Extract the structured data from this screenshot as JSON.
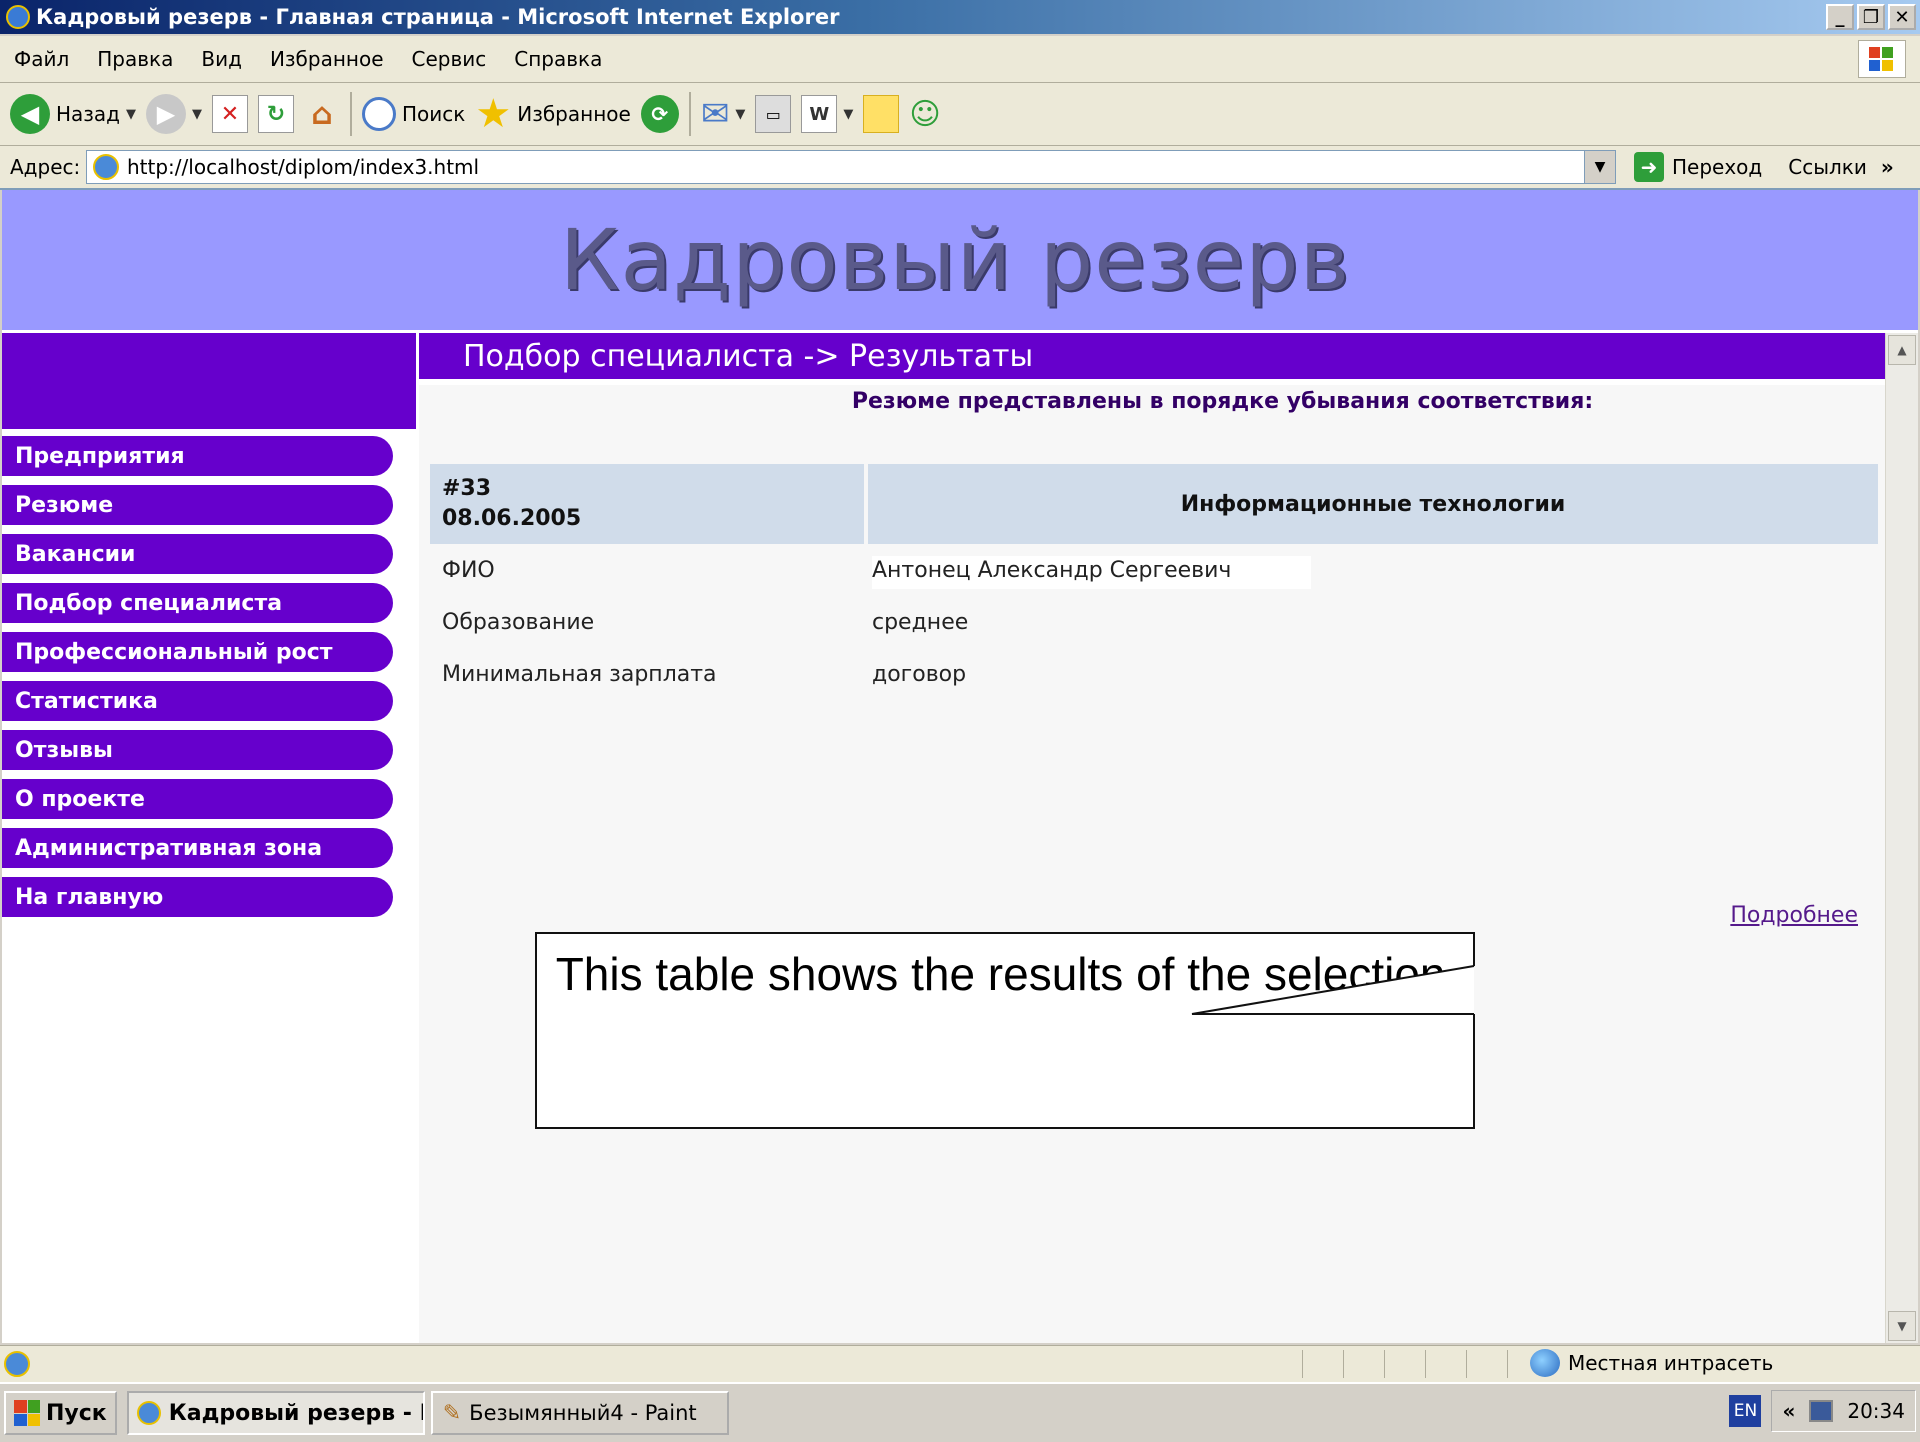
{
  "window": {
    "title": "Кадровый резерв - Главная страница - Microsoft Internet Explorer",
    "min": "_",
    "max": "❐",
    "close": "✕"
  },
  "menu": [
    "Файл",
    "Правка",
    "Вид",
    "Избранное",
    "Сервис",
    "Справка"
  ],
  "toolbar": {
    "back_label": "Назад",
    "search_label": "Поиск",
    "favorites_label": "Избранное"
  },
  "address": {
    "label": "Адрес:",
    "url": "http://localhost/diplom/index3.html",
    "go_label": "Переход",
    "links_label": "Ссылки",
    "links_chevron": "»"
  },
  "page": {
    "site_title": "Кадровый резерв",
    "nav": [
      "Предприятия",
      "Резюме",
      "Вакансии",
      "Подбор специалиста",
      "Профессиональный рост",
      "Статистика",
      "Отзывы",
      "О проекте",
      "Административная зона",
      "На главную"
    ],
    "section_title": "Подбор специалиста -> Результаты",
    "intro": "Резюме представлены в порядке убывания соответствия:",
    "result": {
      "id": "#33",
      "date": "08.06.2005",
      "field": "Информационные технологии",
      "rows": [
        {
          "key": "ФИО",
          "value": "Антонец Александр Сергеевич"
        },
        {
          "key": "Образование",
          "value": "среднее"
        },
        {
          "key": "Минимальная зарплата",
          "value": "договор"
        }
      ],
      "more_link": "Подробнее"
    }
  },
  "callout": {
    "text": "This table shows the results of the selection."
  },
  "status": {
    "zone": "Местная интрасеть"
  },
  "taskbar": {
    "start_label": "Пуск",
    "task1": "Кадровый резерв - Г...",
    "task2": "Безымянный4 - Paint",
    "lang": "EN",
    "tray_chevron": "«",
    "time": "20:34"
  }
}
